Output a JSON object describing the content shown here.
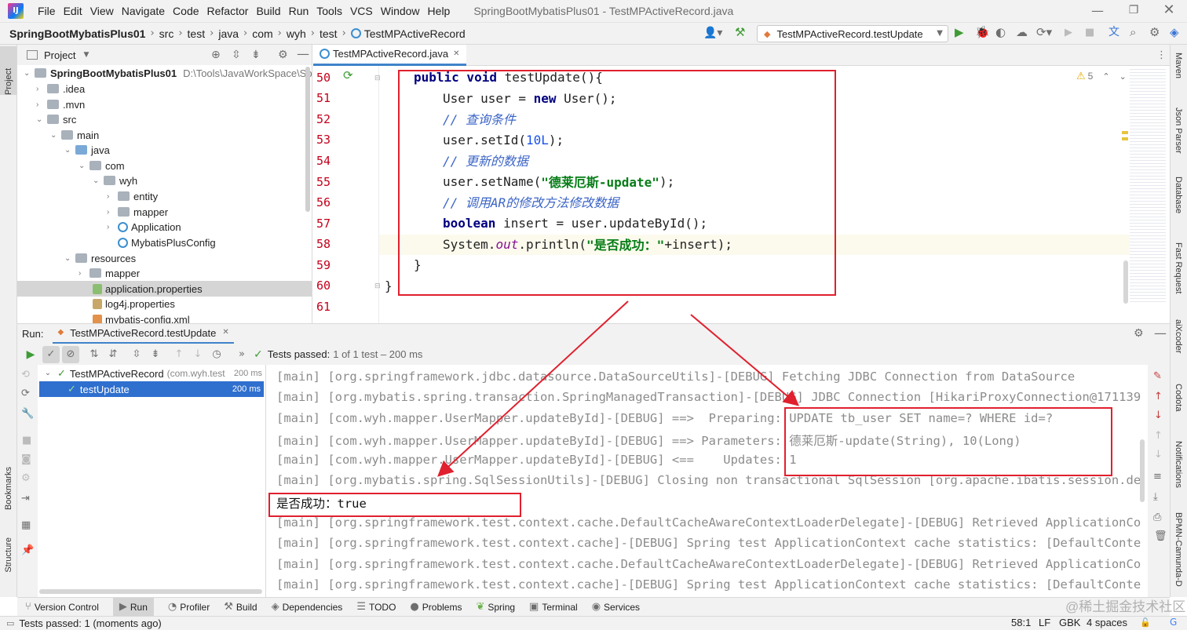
{
  "menubar": {
    "items": [
      "File",
      "Edit",
      "View",
      "Navigate",
      "Code",
      "Refactor",
      "Build",
      "Run",
      "Tools",
      "VCS",
      "Window",
      "Help"
    ],
    "window_title": "SpringBootMybatisPlus01 - TestMPActiveRecord.java"
  },
  "navbar": {
    "breadcrumbs": [
      "SpringBootMybatisPlus01",
      "src",
      "test",
      "java",
      "com",
      "wyh",
      "test",
      "TestMPActiveRecord"
    ],
    "run_config": "TestMPActiveRecord.testUpdate"
  },
  "left_stripe": {
    "project": "Project",
    "bookmarks": "Bookmarks",
    "structure": "Structure"
  },
  "right_stripe": [
    "Maven",
    "Json Parser",
    "Database",
    "Fast Request",
    "aiXcoder",
    "Codota",
    "Notifications",
    "BPMN-Camunda-D"
  ],
  "project_panel": {
    "title": "Project",
    "root_name": "SpringBootMybatisPlus01",
    "root_path": "D:\\Tools\\JavaWorkSpace\\Sprin",
    "nodes": [
      ".idea",
      ".mvn",
      "src",
      "main",
      "java",
      "com",
      "wyh",
      "entity",
      "mapper",
      "Application",
      "MybatisPlusConfig",
      "resources",
      "mapper",
      "application.properties",
      "log4j.properties",
      "mybatis-config.xml"
    ]
  },
  "editor": {
    "tab": "TestMPActiveRecord.java",
    "warning_count": "5",
    "line_numbers": [
      "50",
      "51",
      "52",
      "53",
      "54",
      "55",
      "56",
      "57",
      "58",
      "59",
      "60",
      "61"
    ],
    "code": {
      "l50_kw": "public void",
      "l50_rest": " testUpdate(){",
      "l51_a": "User user = ",
      "l51_kw": "new",
      "l51_b": " User();",
      "l52": "// 查询条件",
      "l53_a": "user.setId(",
      "l53_num": "10L",
      "l53_b": ");",
      "l54": "// 更新的数据",
      "l55_a": "user.setName(",
      "l55_str": "\"德莱厄斯-update\"",
      "l55_b": ");",
      "l56": "// 调用AR的修改方法修改数据",
      "l57_kw": "boolean",
      "l57_rest": " insert = user.updateById();",
      "l58_a": "System.",
      "l58_it": "out",
      "l58_b": ".println(",
      "l58_str": "\"是否成功：\"",
      "l58_c": "+insert);",
      "l59": "}",
      "l60": "}"
    }
  },
  "run_panel": {
    "label": "Run:",
    "tab": "TestMPActiveRecord.testUpdate",
    "status_label": "Tests passed:",
    "status_value": "1 of 1 test – 200 ms",
    "tree": [
      {
        "name": "TestMPActiveRecord",
        "detail": "(com.wyh.test",
        "time": "200 ms"
      },
      {
        "name": "testUpdate",
        "detail": "",
        "time": "200 ms"
      }
    ],
    "console": [
      "[main] [org.springframework.jdbc.datasource.DataSourceUtils]-[DEBUG] Fetching JDBC Connection from DataSource",
      "[main] [org.mybatis.spring.transaction.SpringManagedTransaction]-[DEBUG] JDBC Connection [HikariProxyConnection@171139",
      "[main] [com.wyh.mapper.UserMapper.updateById]-[DEBUG] ==>  Preparing: UPDATE tb_user SET name=? WHERE id=?",
      "[main] [com.wyh.mapper.UserMapper.updateById]-[DEBUG] ==> Parameters: 德莱厄斯-update(String), 10(Long)",
      "[main] [com.wyh.mapper.UserMapper.updateById]-[DEBUG] <==    Updates: 1",
      "[main] [org.mybatis.spring.SqlSessionUtils]-[DEBUG] Closing non transactional SqlSession [org.apache.ibatis.session.de",
      "是否成功：true",
      "[main] [org.springframework.test.context.cache.DefaultCacheAwareContextLoaderDelegate]-[DEBUG] Retrieved ApplicationCo",
      "[main] [org.springframework.test.context.cache]-[DEBUG] Spring test ApplicationContext cache statistics: [DefaultConte",
      "[main] [org.springframework.test.context.cache.DefaultCacheAwareContextLoaderDelegate]-[DEBUG] Retrieved ApplicationCo",
      "[main] [org.springframework.test.context.cache]-[DEBUG] Spring test ApplicationContext cache statistics: [DefaultConte"
    ]
  },
  "bottom_tabs": [
    "Version Control",
    "Run",
    "Profiler",
    "Build",
    "Dependencies",
    "TODO",
    "Problems",
    "Spring",
    "Terminal",
    "Services"
  ],
  "statusbar": {
    "message": "Tests passed: 1 (moments ago)",
    "position": "58:1",
    "line_sep": "LF",
    "encoding": "GBK",
    "indent": "4 spaces",
    "watermark": "@稀土掘金技术社区"
  },
  "colors": {
    "annotation": "#e0202e",
    "pass": "#3f9c35",
    "selection": "#2f6fce"
  }
}
